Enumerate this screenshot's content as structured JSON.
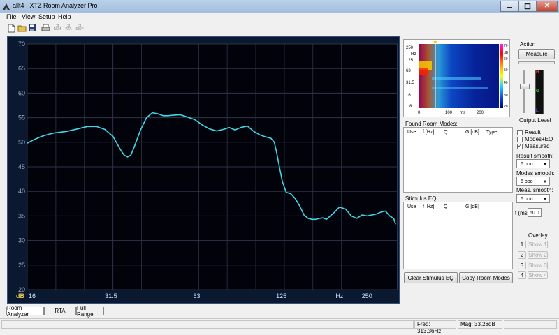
{
  "window": {
    "title": "allt4 - XTZ Room Analyzer Pro",
    "close_glyph": "✕"
  },
  "menu": [
    "File",
    "View",
    "Setup",
    "Help"
  ],
  "toolbar": {
    "icons": [
      "new-file-icon",
      "open-folder-icon",
      "save-icon",
      "print-icon",
      "rsm-icon",
      "rta-icon",
      "sweep-icon"
    ],
    "labels": [
      "RSM",
      "RTA",
      "SWP"
    ]
  },
  "chart_data": {
    "type": "line",
    "unit_label": "dB",
    "xlabel": "Hz",
    "x_scale": "log",
    "xlim": [
      16,
      320
    ],
    "ylim": [
      20,
      70
    ],
    "x_ticks": [
      "16",
      "31.5",
      "63",
      "125",
      "250"
    ],
    "y_ticks": [
      "20",
      "25",
      "30",
      "35",
      "40",
      "45",
      "50",
      "55",
      "60",
      "65",
      "70"
    ],
    "grid": true,
    "line_color": "#3fd7e6",
    "series": [
      {
        "x": [
          16,
          17,
          18,
          19,
          20,
          22,
          24,
          26,
          28,
          30,
          32,
          34,
          35,
          36,
          37,
          38,
          40,
          42,
          44,
          46,
          48,
          50,
          52,
          55,
          58,
          62,
          66,
          70,
          74,
          78,
          82,
          86,
          90,
          95,
          100,
          105,
          110,
          115,
          118,
          120,
          123,
          126,
          130,
          135,
          140,
          145,
          150,
          155,
          160,
          165,
          170,
          175,
          180,
          190,
          200,
          210,
          220,
          230,
          240,
          250,
          260,
          270,
          280,
          290,
          300,
          310,
          315
        ],
        "y": [
          49.8,
          50.6,
          51.2,
          51.6,
          51.9,
          52.2,
          52.7,
          53.2,
          53.2,
          52.6,
          51.2,
          48.5,
          47.4,
          47.0,
          47.4,
          49.0,
          52.5,
          55.0,
          56.0,
          55.8,
          55.4,
          55.4,
          55.5,
          55.6,
          55.2,
          54.6,
          53.5,
          52.7,
          52.3,
          52.6,
          53.0,
          52.5,
          53.0,
          53.3,
          52.2,
          51.5,
          51.1,
          50.8,
          50.0,
          48.2,
          45.0,
          42.0,
          39.8,
          39.5,
          38.5,
          37.0,
          35.2,
          34.5,
          34.3,
          34.3,
          34.5,
          34.6,
          34.3,
          35.5,
          36.8,
          36.4,
          35.0,
          34.5,
          35.2,
          35.0,
          35.2,
          35.4,
          35.8,
          36.0,
          35.0,
          34.5,
          33.3
        ]
      }
    ]
  },
  "spectrogram": {
    "y_ticks": [
      "250",
      "Hz",
      "125",
      "63",
      "31.5",
      "16",
      "8"
    ],
    "x_ticks": [
      "0",
      "100",
      "ms",
      "200"
    ],
    "scale_unit": "dB",
    "scale_ticks": [
      "70",
      "60",
      "50",
      "40",
      "30",
      "20"
    ]
  },
  "action": {
    "title": "Action",
    "measure": "Measure",
    "output_level": "Output Level",
    "meter_labels": [
      "H",
      "G",
      "L"
    ]
  },
  "room_modes": {
    "title": "Found Room Modes:",
    "columns": [
      "Use",
      "f [Hz]",
      "Q",
      "G [dB]",
      "Type"
    ]
  },
  "stimulus_eq": {
    "title": "Stimulus EQ:",
    "columns": [
      "Use",
      "f [Hz]",
      "Q",
      "G [dB]"
    ]
  },
  "buttons": {
    "clear_eq": "Clear Stimulus EQ",
    "copy_modes": "Copy Room Modes"
  },
  "checkboxes": [
    {
      "label": "Result",
      "checked": false
    },
    {
      "label": "Modes+EQ",
      "checked": false
    },
    {
      "label": "Measured",
      "checked": true
    }
  ],
  "check_glyph": "✓",
  "smoothing": [
    {
      "label": "Result smooth:",
      "value": "6 ppo"
    },
    {
      "label": "Modes smooth:",
      "value": "6 ppo"
    },
    {
      "label": "Meas. smooth:",
      "value": "6 ppo"
    }
  ],
  "dropdown_glyph": "▼",
  "time": {
    "label": "t (ms)",
    "value": "50.0"
  },
  "overlay": {
    "title": "Overlay",
    "items": [
      {
        "num": "1",
        "label": "Show 1"
      },
      {
        "num": "2",
        "label": "Show 2"
      },
      {
        "num": "3",
        "label": "Show 3"
      },
      {
        "num": "4",
        "label": "Show 4"
      }
    ]
  },
  "tabs": [
    "Room Analyzer",
    "RTA",
    "Full Range"
  ],
  "status": {
    "freq": "Freq: 313.36Hz",
    "mag": "Mag: 33.28dB"
  }
}
